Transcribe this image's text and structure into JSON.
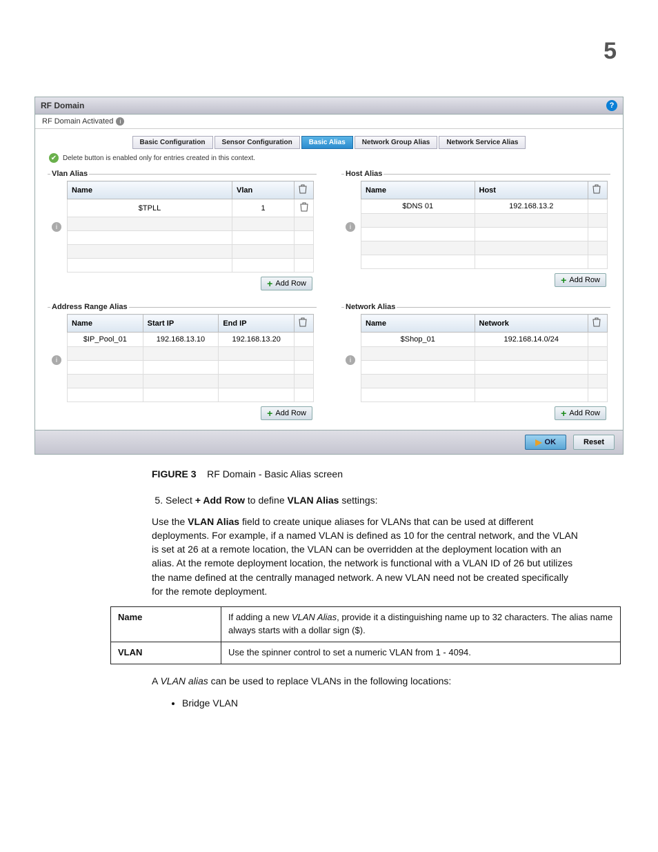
{
  "page_number": "5",
  "app": {
    "title": "RF Domain",
    "subbar": "RF Domain Activated",
    "delete_note": "Delete button is enabled only for entries created in this context.",
    "tabs": {
      "basic_config": "Basic Configuration",
      "sensor_config": "Sensor Configuration",
      "basic_alias": "Basic Alias",
      "net_group_alias": "Network Group Alias",
      "net_service_alias": "Network Service Alias"
    },
    "btn_add_row": "Add Row",
    "btn_ok": "OK",
    "btn_reset": "Reset"
  },
  "vlan": {
    "legend": "Vlan Alias",
    "h_name": "Name",
    "h_vlan": "Vlan",
    "r0_name": "$TPLL",
    "r0_vlan": "1"
  },
  "host": {
    "legend": "Host Alias",
    "h_name": "Name",
    "h_host": "Host",
    "r0_name": "$DNS 01",
    "r0_host": "192.168.13.2"
  },
  "addr": {
    "legend": "Address Range Alias",
    "h_name": "Name",
    "h_start": "Start IP",
    "h_end": "End IP",
    "r0_name": "$IP_Pool_01",
    "r0_start": "192.168.13.10",
    "r0_end": "192.168.13.20"
  },
  "net": {
    "legend": "Network Alias",
    "h_name": "Name",
    "h_network": "Network",
    "r0_name": "$Shop_01",
    "r0_network": "192.168.14.0/24"
  },
  "doc": {
    "fig_label": "FIGURE 3",
    "fig_caption": "RF Domain - Basic Alias screen",
    "step5_prefix": "Select",
    "step5_bold1": "+ Add Row",
    "step5_mid": "to define",
    "step5_bold2": "VLAN Alias",
    "step5_suffix": "settings:",
    "para1_prefix": "Use the",
    "para1_bold": "VLAN Alias",
    "para1_rest": "field to create unique aliases for VLANs that can be used at different deployments. For example, if a named VLAN is defined as 10 for the central network, and the VLAN is set at 26 at a remote location, the VLAN can be overridden at the deployment location with an alias. At the remote deployment location, the network is functional with a VLAN ID of 26 but utilizes the name defined at the centrally managed network. A new VLAN need not be created specifically for the remote deployment.",
    "tbl_name_label": "Name",
    "tbl_name_desc_prefix": "If adding a new",
    "tbl_name_desc_em": "VLAN Alias",
    "tbl_name_desc_suffix": ", provide it a distinguishing name up to 32 characters. The alias name always starts with a dollar sign ($).",
    "tbl_vlan_label": "VLAN",
    "tbl_vlan_desc": "Use the spinner control to set a numeric VLAN from 1 - 4094.",
    "para2_prefix": "A",
    "para2_em": "VLAN alias",
    "para2_suffix": "can be used to replace VLANs in the following locations:",
    "bullet1": "Bridge VLAN"
  }
}
